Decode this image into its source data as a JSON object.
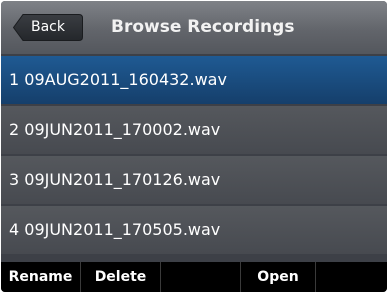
{
  "header": {
    "back_label": "Back",
    "title": "Browse Recordings"
  },
  "recordings": [
    {
      "label": "1 09AUG2011_160432.wav",
      "selected": true
    },
    {
      "label": "2 09JUN2011_170002.wav",
      "selected": false
    },
    {
      "label": "3 09JUN2011_170126.wav",
      "selected": false
    },
    {
      "label": "4 09JUN2011_170505.wav",
      "selected": false
    }
  ],
  "softkeys": {
    "rename": "Rename",
    "delete": "Delete",
    "blank": "",
    "open": "Open",
    "blank_right": ""
  },
  "colors": {
    "selected_row": "#1f5a93",
    "row": "#4e5156",
    "softkey_bar": "#000000"
  }
}
